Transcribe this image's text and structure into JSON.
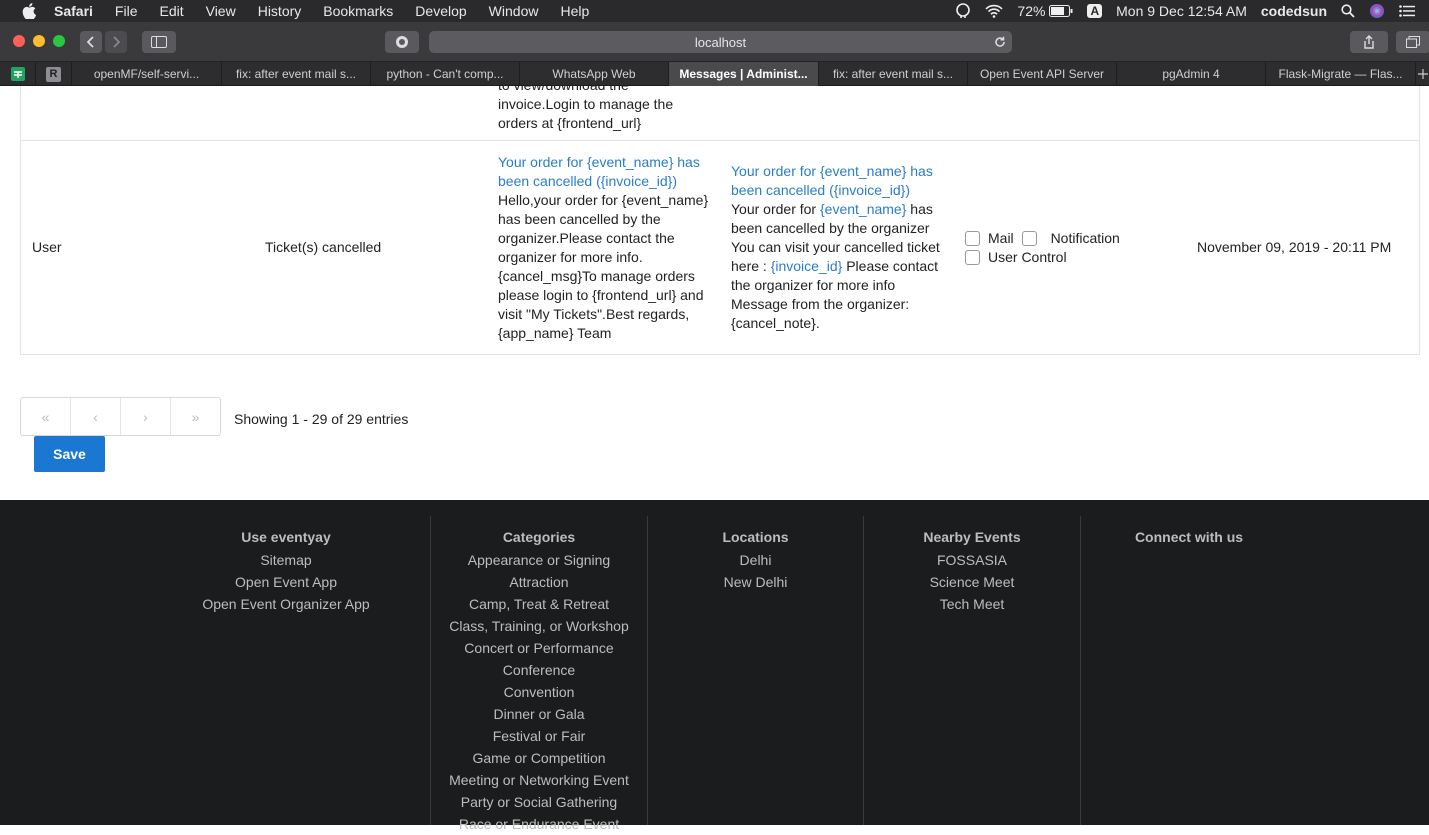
{
  "menubar": {
    "app": "Safari",
    "items": [
      "File",
      "Edit",
      "View",
      "History",
      "Bookmarks",
      "Develop",
      "Window",
      "Help"
    ],
    "battery": "72%",
    "input_source": "A",
    "datetime": "Mon 9 Dec  12:54 AM",
    "user": "codedsun"
  },
  "browser": {
    "url": "localhost",
    "tabs": [
      {
        "label": "openMF/self-servi..."
      },
      {
        "label": "fix: after event mail s..."
      },
      {
        "label": "python - Can't comp..."
      },
      {
        "label": "WhatsApp Web"
      },
      {
        "label": "Messages | Administ..."
      },
      {
        "label": "fix: after event mail s..."
      },
      {
        "label": "Open Event API Server"
      },
      {
        "label": "pgAdmin 4"
      },
      {
        "label": "Flask-Migrate — Flas..."
      }
    ],
    "active_tab": 4
  },
  "prev_row": {
    "line1": "to view/download the",
    "line2": "invoice.Login to manage the",
    "line3": "orders at {frontend_url}"
  },
  "row": {
    "recipient": "User",
    "trigger": "Ticket(s) cancelled",
    "email": {
      "subject1": "Your order for {event_name} has",
      "subject2": "been cancelled ({invoice_id})",
      "b1": "Hello,your order for {event_name}",
      "b2": "has been cancelled by the",
      "b3": "organizer.Please contact the",
      "b4": "organizer for more info.",
      "b5": "{cancel_msg}To manage orders",
      "b6": "please login to {frontend_url} and",
      "b7": "visit \"My Tickets\".Best regards,",
      "b8": "{app_name} Team"
    },
    "notification": {
      "subject1": "Your order for {event_name} has",
      "subject2": "been cancelled ({invoice_id})",
      "b1a": "Your order for ",
      "b1b": "{event_name}",
      "b1c": " has",
      "b2": "been cancelled by the organizer",
      "b3": "You can visit your cancelled ticket",
      "b4a": "here : ",
      "b4b": "{invoice_id}",
      "b4c": " Please contact",
      "b5": "the organizer for more info",
      "b6": "Message from the organizer:",
      "b7": "{cancel_note}."
    },
    "options": {
      "mail": "Mail",
      "notification": "Notification",
      "user_control": "User Control"
    },
    "mail_checked": false,
    "notification_checked": false,
    "user_control_checked": false,
    "sent_at": "November 09, 2019 - 20:11 PM"
  },
  "pagination": {
    "first": "«",
    "prev": "‹",
    "next": "›",
    "last": "»",
    "summary": "Showing 1 - 29 of 29 entries"
  },
  "save_label": "Save",
  "footer": {
    "use": {
      "title": "Use eventyay",
      "items": [
        "Sitemap",
        "Open Event App",
        "Open Event Organizer App"
      ]
    },
    "categories": {
      "title": "Categories",
      "items": [
        "Appearance or Signing",
        "Attraction",
        "Camp, Treat & Retreat",
        "Class, Training, or Workshop",
        "Concert or Performance",
        "Conference",
        "Convention",
        "Dinner or Gala",
        "Festival or Fair",
        "Game or Competition",
        "Meeting or Networking Event",
        "Party or Social Gathering",
        "Race or Endurance Event"
      ]
    },
    "locations": {
      "title": "Locations",
      "items": [
        "Delhi",
        "New Delhi"
      ]
    },
    "nearby": {
      "title": "Nearby Events",
      "items": [
        "FOSSASIA",
        "Science Meet",
        "Tech Meet"
      ]
    },
    "connect": {
      "title": "Connect with us"
    }
  }
}
